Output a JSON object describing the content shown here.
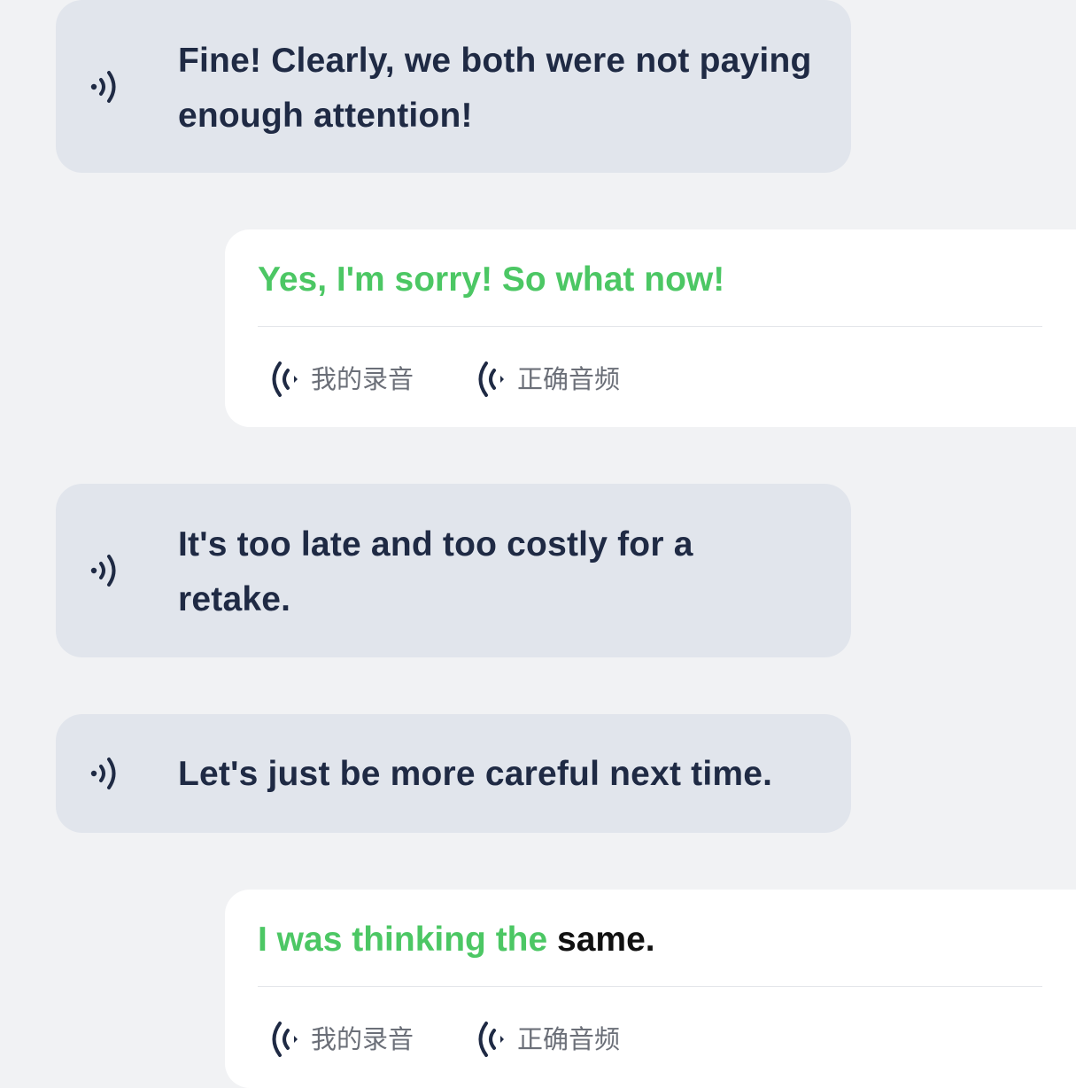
{
  "messages": [
    {
      "type": "prompt",
      "text": "Fine! Clearly, we both were not paying enough attention!",
      "icon": "speaker-icon"
    },
    {
      "type": "reply",
      "segments": [
        {
          "text": "Yes, I'm sorry! So what now!",
          "status": "correct"
        }
      ],
      "buttons": {
        "my_recording": "我的录音",
        "correct_audio": "正确音频"
      }
    },
    {
      "type": "prompt",
      "text": "It's too late and too costly for a retake.",
      "icon": "speaker-icon"
    },
    {
      "type": "prompt",
      "text": "Let's just be more careful next time.",
      "icon": "speaker-icon"
    },
    {
      "type": "reply",
      "segments": [
        {
          "text": "I was thinking the ",
          "status": "correct"
        },
        {
          "text": "same.",
          "status": "incorrect"
        }
      ],
      "buttons": {
        "my_recording": "我的录音",
        "correct_audio": "正确音频"
      }
    }
  ],
  "colors": {
    "correct": "#4cc764",
    "incorrect": "#111111",
    "prompt_bubble": "#e1e5ec",
    "reply_card": "#ffffff",
    "background": "#f1f2f4"
  }
}
